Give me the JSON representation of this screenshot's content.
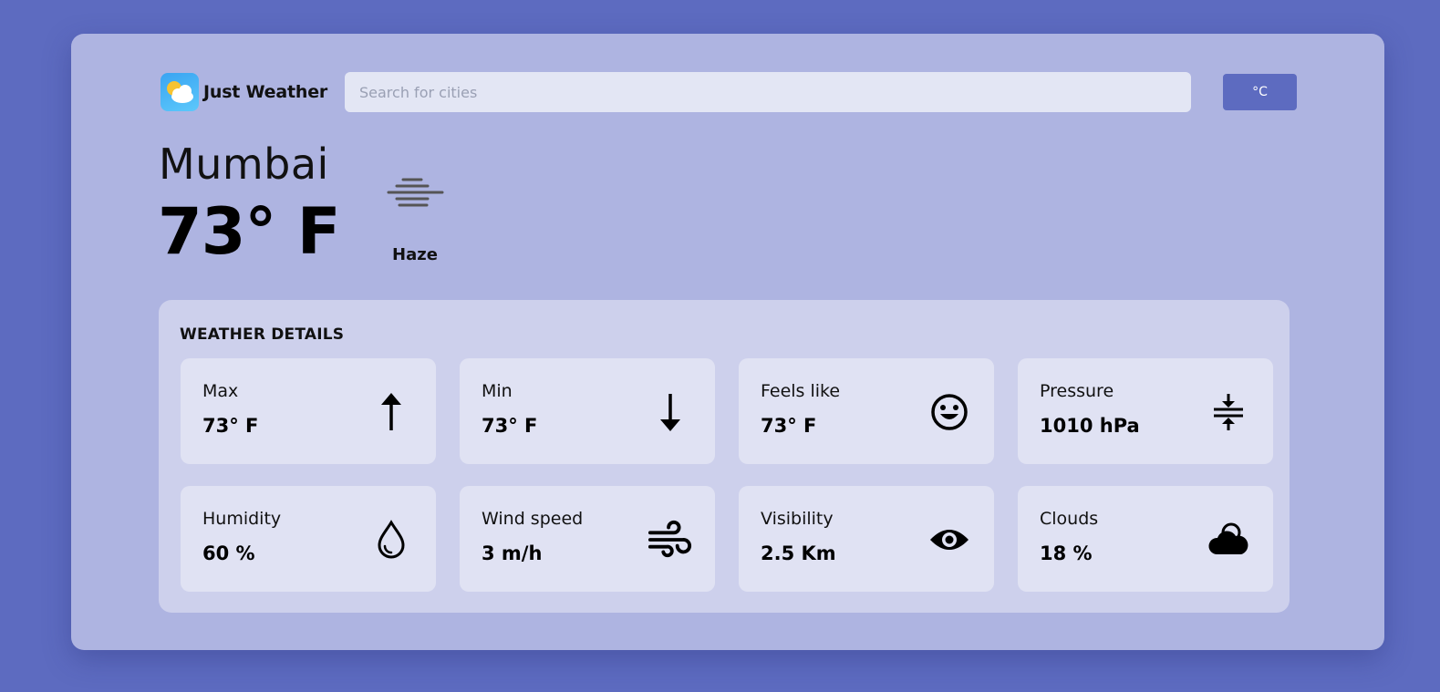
{
  "app": {
    "name": "Just Weather"
  },
  "search": {
    "placeholder": "Search for cities"
  },
  "unit_toggle": {
    "label": "°C"
  },
  "current": {
    "city": "Mumbai",
    "temperature": "73° F",
    "condition": "Haze",
    "condition_icon": "haze-icon"
  },
  "details": {
    "title": "WEATHER DETAILS",
    "tiles": [
      {
        "label": "Max",
        "value": "73° F",
        "icon": "arrow-up-icon"
      },
      {
        "label": "Min",
        "value": "73° F",
        "icon": "arrow-down-icon"
      },
      {
        "label": "Feels like",
        "value": "73° F",
        "icon": "smiley-icon"
      },
      {
        "label": "Pressure",
        "value": "1010 hPa",
        "icon": "compress-icon"
      },
      {
        "label": "Humidity",
        "value": "60 %",
        "icon": "droplet-icon"
      },
      {
        "label": "Wind speed",
        "value": "3 m/h",
        "icon": "wind-icon"
      },
      {
        "label": "Visibility",
        "value": "2.5 Km",
        "icon": "eye-icon"
      },
      {
        "label": "Clouds",
        "value": "18 %",
        "icon": "cloud-icon"
      }
    ]
  },
  "colors": {
    "background": "#5d6bc0",
    "card": "#aeb4e1",
    "panel": "#cdd0ec",
    "tile": "#e0e2f3",
    "accent": "#5d6bc0"
  }
}
